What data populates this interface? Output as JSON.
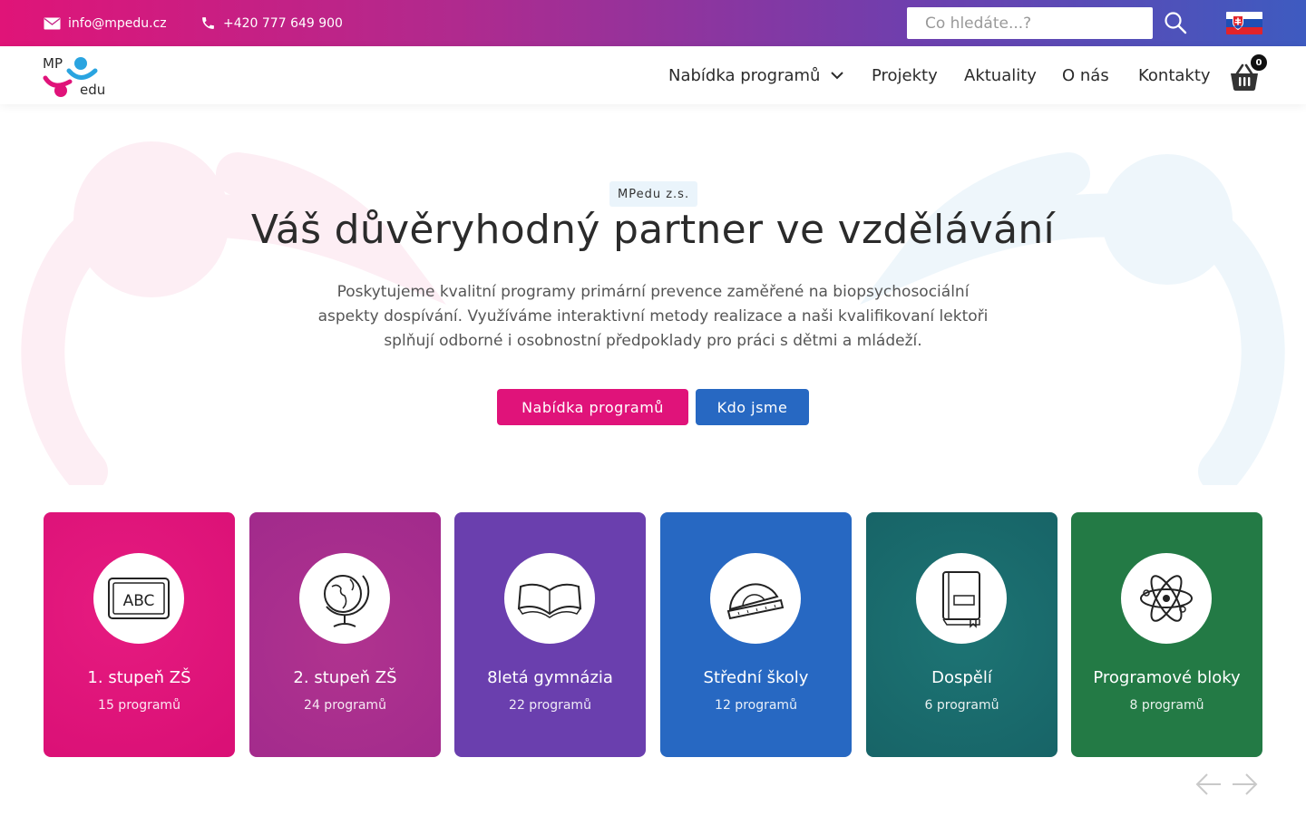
{
  "topbar": {
    "email": "info@mpedu.cz",
    "phone": "+420 777 649 900",
    "search_placeholder": "Co hledáte...?",
    "language_flag": "flag-sk-icon"
  },
  "logo": {
    "text_top": "MP",
    "text_bottom": "edu"
  },
  "nav": {
    "programs": "Nabídka programů",
    "projects": "Projekty",
    "news": "Aktuality",
    "about": "O nás",
    "contacts": "Kontakty",
    "cart_count": "0"
  },
  "hero": {
    "badge": "MPedu z.s.",
    "title": "Váš důvěryhodný partner ve vzdělávání",
    "text": "Poskytujeme kvalitní programy primární prevence zaměřené na biopsychosociální aspekty dospívání. Využíváme interaktivní metody realizace a naši kvalifikovaní lektoři splňují odborné i osobnostní předpoklady pro práci s dětmi a mládeží.",
    "btn_programs": "Nabídka programů",
    "btn_about": "Kdo jsme"
  },
  "cards": [
    {
      "title": "1. stupeň ZŠ",
      "count": "15 programů",
      "icon": "abc-board-icon",
      "color": "#e0137a"
    },
    {
      "title": "2. stupeň ZŠ",
      "count": "24 programů",
      "icon": "globe-icon",
      "color": "#a82f90"
    },
    {
      "title": "8letá gymnázia",
      "count": "22 programů",
      "icon": "open-book-icon",
      "color": "#6a3fae"
    },
    {
      "title": "Střední školy",
      "count": "12 programů",
      "icon": "protractor-icon",
      "color": "#2768c2"
    },
    {
      "title": "Dospělí",
      "count": "6 programů",
      "icon": "closed-book-icon",
      "color": "#186a70"
    },
    {
      "title": "Programové bloky",
      "count": "8 programů",
      "icon": "atom-icon",
      "color": "#237a45"
    }
  ],
  "colors": {
    "brand_pink": "#e0137a",
    "brand_blue": "#2768c2",
    "topbar_gradient": [
      "#e01478",
      "#6e3fae",
      "#3e5bc0"
    ]
  }
}
